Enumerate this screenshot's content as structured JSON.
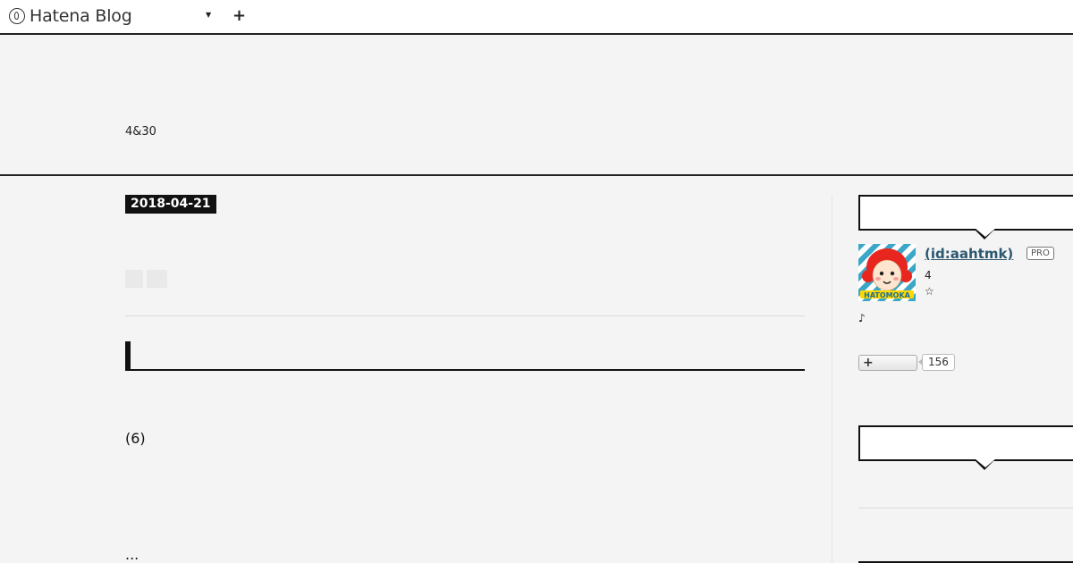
{
  "header": {
    "brand": "Hatena Blog",
    "dropdown_icon": "caret-down-icon",
    "plus_label": "+"
  },
  "blog": {
    "description": "4&30"
  },
  "entry": {
    "date": "2018-04-21",
    "paragraph_1": "(6)",
    "paragraph_2": "..."
  },
  "sidebar": {
    "profile": {
      "username": " (id:aahtmk)",
      "badge": "PRO",
      "line_1": "4",
      "line_2": "☆",
      "line_3": "♪"
    },
    "follow": {
      "button_label": "+",
      "count": "156"
    }
  },
  "colors": {
    "link": "#2b5770",
    "dark": "#111111",
    "background": "#f4f4f4",
    "avatar_stripe": "#3aa7c9",
    "avatar_hair": "#e8261f"
  }
}
